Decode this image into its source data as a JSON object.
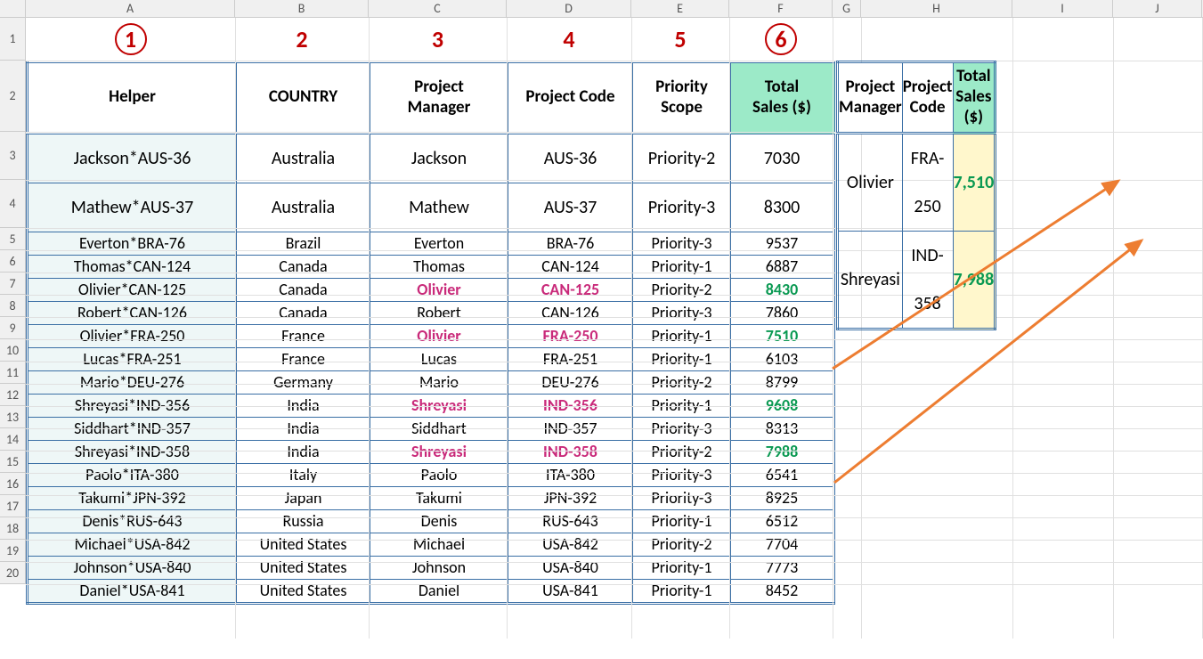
{
  "columns": {
    "letters": [
      "A",
      "B",
      "C",
      "D",
      "E",
      "F",
      "G",
      "H",
      "I",
      "J"
    ],
    "widths": [
      235,
      150,
      155,
      140,
      110,
      116,
      32,
      170,
      113,
      100
    ],
    "col_after_j": 130
  },
  "rows": {
    "heights": [
      48,
      80,
      54,
      54,
      25,
      25,
      25,
      25,
      25,
      25,
      25,
      25,
      25,
      25,
      25,
      25,
      25,
      25,
      25,
      25
    ],
    "numbers": [
      "1",
      "2",
      "3",
      "4",
      "5",
      "6",
      "7",
      "8",
      "9",
      "10",
      "11",
      "12",
      "13",
      "14",
      "15",
      "16",
      "17",
      "18",
      "19",
      "20"
    ]
  },
  "num_row": [
    "1",
    "2",
    "3",
    "4",
    "5",
    "6"
  ],
  "main_headers": [
    "Helper",
    "COUNTRY",
    "Project Manager",
    "Project Code",
    "Priority Scope",
    "Total Sales ($)"
  ],
  "lookup_headers": [
    "Project Manager",
    "Project Code",
    "Total Sales ($)"
  ],
  "main_data": [
    {
      "helper": "Jackson*AUS-36",
      "country": "Australia",
      "pm": "Jackson",
      "code": "AUS-36",
      "priority": "Priority-2",
      "sales": "7030",
      "hi": false
    },
    {
      "helper": "Mathew*AUS-37",
      "country": "Australia",
      "pm": "Mathew",
      "code": "AUS-37",
      "priority": "Priority-3",
      "sales": "8300",
      "hi": false
    },
    {
      "helper": "Everton*BRA-76",
      "country": "Brazil",
      "pm": "Everton",
      "code": "BRA-76",
      "priority": "Priority-3",
      "sales": "9537",
      "hi": false
    },
    {
      "helper": "Thomas*CAN-124",
      "country": "Canada",
      "pm": "Thomas",
      "code": "CAN-124",
      "priority": "Priority-1",
      "sales": "6887",
      "hi": false
    },
    {
      "helper": "Olivier*CAN-125",
      "country": "Canada",
      "pm": "Olivier",
      "code": "CAN-125",
      "priority": "Priority-2",
      "sales": "8430",
      "hi": true
    },
    {
      "helper": "Robert*CAN-126",
      "country": "Canada",
      "pm": "Robert",
      "code": "CAN-126",
      "priority": "Priority-3",
      "sales": "7860",
      "hi": false
    },
    {
      "helper": "Olivier*FRA-250",
      "country": "France",
      "pm": "Olivier",
      "code": "FRA-250",
      "priority": "Priority-1",
      "sales": "7510",
      "hi": true
    },
    {
      "helper": "Lucas*FRA-251",
      "country": "France",
      "pm": "Lucas",
      "code": "FRA-251",
      "priority": "Priority-1",
      "sales": "6103",
      "hi": false
    },
    {
      "helper": "Mario*DEU-276",
      "country": "Germany",
      "pm": "Mario",
      "code": "DEU-276",
      "priority": "Priority-2",
      "sales": "8799",
      "hi": false
    },
    {
      "helper": "Shreyasi*IND-356",
      "country": "India",
      "pm": "Shreyasi",
      "code": "IND-356",
      "priority": "Priority-1",
      "sales": "9608",
      "hi": true
    },
    {
      "helper": "Siddhart*IND-357",
      "country": "India",
      "pm": "Siddhart",
      "code": "IND-357",
      "priority": "Priority-3",
      "sales": "8313",
      "hi": false
    },
    {
      "helper": "Shreyasi*IND-358",
      "country": "India",
      "pm": "Shreyasi",
      "code": "IND-358",
      "priority": "Priority-2",
      "sales": "7988",
      "hi": true
    },
    {
      "helper": "Paolo*ITA-380",
      "country": "Italy",
      "pm": "Paolo",
      "code": "ITA-380",
      "priority": "Priority-3",
      "sales": "6541",
      "hi": false
    },
    {
      "helper": "Takumi*JPN-392",
      "country": "Japan",
      "pm": "Takumi",
      "code": "JPN-392",
      "priority": "Priority-3",
      "sales": "8925",
      "hi": false
    },
    {
      "helper": "Denis*RUS-643",
      "country": "Russia",
      "pm": "Denis",
      "code": "RUS-643",
      "priority": "Priority-1",
      "sales": "6512",
      "hi": false
    },
    {
      "helper": "Michael*USA-842",
      "country": "United States",
      "pm": "Michael",
      "code": "USA-842",
      "priority": "Priority-2",
      "sales": "7704",
      "hi": false
    },
    {
      "helper": "Johnson*USA-840",
      "country": "United States",
      "pm": "Johnson",
      "code": "USA-840",
      "priority": "Priority-1",
      "sales": "7773",
      "hi": false
    },
    {
      "helper": "Daniel*USA-841",
      "country": "United States",
      "pm": "Daniel",
      "code": "USA-841",
      "priority": "Priority-1",
      "sales": "8452",
      "hi": false
    }
  ],
  "lookup_data": [
    {
      "pm": "Olivier",
      "code": "FRA-250",
      "sales": "7,510"
    },
    {
      "pm": "Shreyasi",
      "code": "IND-358",
      "sales": "7,988"
    }
  ],
  "chart_data": {
    "type": "table",
    "title": "VLOOKUP helper-column example",
    "main_table": {
      "columns": [
        "Helper",
        "COUNTRY",
        "Project Manager",
        "Project Code",
        "Priority Scope",
        "Total Sales ($)"
      ],
      "rows": [
        [
          "Jackson*AUS-36",
          "Australia",
          "Jackson",
          "AUS-36",
          "Priority-2",
          7030
        ],
        [
          "Mathew*AUS-37",
          "Australia",
          "Mathew",
          "AUS-37",
          "Priority-3",
          8300
        ],
        [
          "Everton*BRA-76",
          "Brazil",
          "Everton",
          "BRA-76",
          "Priority-3",
          9537
        ],
        [
          "Thomas*CAN-124",
          "Canada",
          "Thomas",
          "CAN-124",
          "Priority-1",
          6887
        ],
        [
          "Olivier*CAN-125",
          "Canada",
          "Olivier",
          "CAN-125",
          "Priority-2",
          8430
        ],
        [
          "Robert*CAN-126",
          "Canada",
          "Robert",
          "CAN-126",
          "Priority-3",
          7860
        ],
        [
          "Olivier*FRA-250",
          "France",
          "Olivier",
          "FRA-250",
          "Priority-1",
          7510
        ],
        [
          "Lucas*FRA-251",
          "France",
          "Lucas",
          "FRA-251",
          "Priority-1",
          6103
        ],
        [
          "Mario*DEU-276",
          "Germany",
          "Mario",
          "DEU-276",
          "Priority-2",
          8799
        ],
        [
          "Shreyasi*IND-356",
          "India",
          "Shreyasi",
          "IND-356",
          "Priority-1",
          9608
        ],
        [
          "Siddhart*IND-357",
          "India",
          "Siddhart",
          "IND-357",
          "Priority-3",
          8313
        ],
        [
          "Shreyasi*IND-358",
          "India",
          "Shreyasi",
          "IND-358",
          "Priority-2",
          7988
        ],
        [
          "Paolo*ITA-380",
          "Italy",
          "Paolo",
          "ITA-380",
          "Priority-3",
          6541
        ],
        [
          "Takumi*JPN-392",
          "Japan",
          "Takumi",
          "JPN-392",
          "Priority-3",
          8925
        ],
        [
          "Denis*RUS-643",
          "Russia",
          "Denis",
          "RUS-643",
          "Priority-1",
          6512
        ],
        [
          "Michael*USA-842",
          "United States",
          "Michael",
          "USA-842",
          "Priority-2",
          7704
        ],
        [
          "Johnson*USA-840",
          "United States",
          "Johnson",
          "USA-840",
          "Priority-1",
          7773
        ],
        [
          "Daniel*USA-841",
          "United States",
          "Daniel",
          "USA-841",
          "Priority-1",
          8452
        ]
      ]
    },
    "lookup_table": {
      "columns": [
        "Project Manager",
        "Project Code",
        "Total Sales ($)"
      ],
      "rows": [
        [
          "Olivier",
          "FRA-250",
          7510
        ],
        [
          "Shreyasi",
          "IND-358",
          7988
        ]
      ]
    },
    "column_index_labels": [
      1,
      2,
      3,
      4,
      5,
      6
    ],
    "circled_indices": [
      1,
      6
    ]
  }
}
